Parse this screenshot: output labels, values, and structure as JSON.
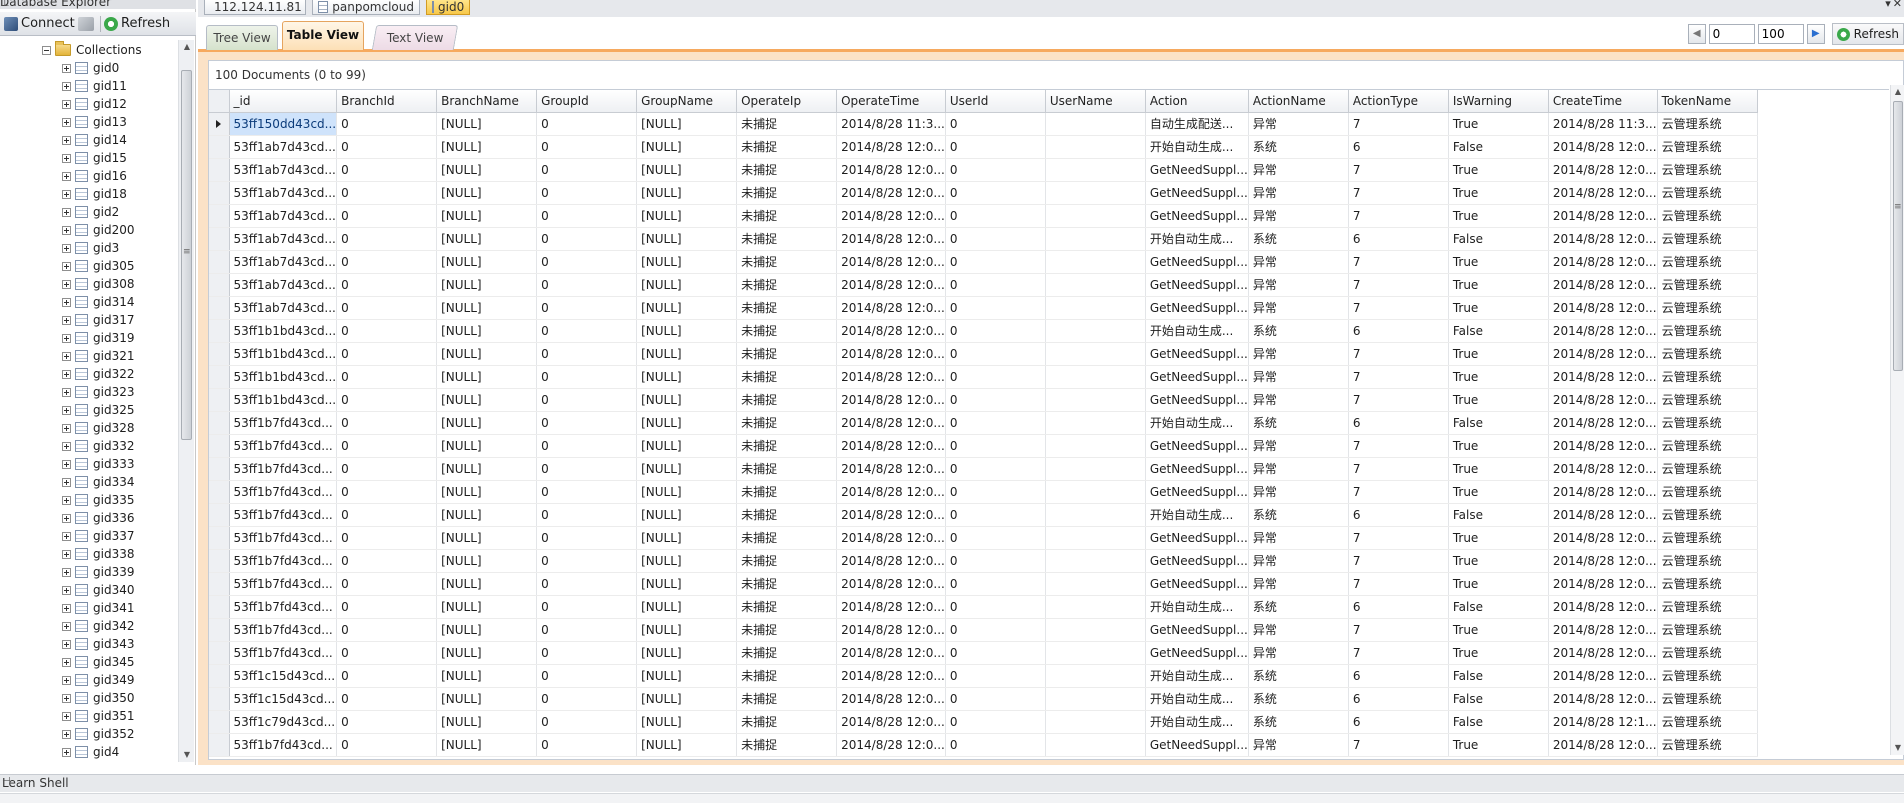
{
  "explorer": {
    "title": "Database Explorer",
    "connect_label": "Connect",
    "refresh_label": "Refresh",
    "collections_label": "Collections",
    "collections": [
      "gid0",
      "gid11",
      "gid12",
      "gid13",
      "gid14",
      "gid15",
      "gid16",
      "gid18",
      "gid2",
      "gid200",
      "gid3",
      "gid305",
      "gid308",
      "gid314",
      "gid317",
      "gid319",
      "gid321",
      "gid322",
      "gid323",
      "gid325",
      "gid328",
      "gid332",
      "gid333",
      "gid334",
      "gid335",
      "gid336",
      "gid337",
      "gid338",
      "gid339",
      "gid340",
      "gid341",
      "gid342",
      "gid343",
      "gid345",
      "gid349",
      "gid350",
      "gid351",
      "gid352",
      "gid4"
    ]
  },
  "doc_tabs": {
    "server": "112.124.11.81",
    "database": "panpomcloud",
    "collection": "gid0"
  },
  "view_tabs": {
    "tree": "Tree View",
    "table": "Table View",
    "text": "Text View"
  },
  "paging": {
    "skip": "0",
    "limit": "100",
    "refresh_label": "Refresh"
  },
  "result": {
    "count_label": "100 Documents (0 to 99)"
  },
  "grid": {
    "columns": [
      "_id",
      "BranchId",
      "BranchName",
      "GroupId",
      "GroupName",
      "OperateIp",
      "OperateTime",
      "UserId",
      "UserName",
      "Action",
      "ActionName",
      "ActionType",
      "IsWarning",
      "CreateTime",
      "TokenName"
    ],
    "rows": [
      [
        "53ff150dd43cd...",
        "0",
        "[NULL]",
        "0",
        "[NULL]",
        "未捕捉",
        "2014/8/28 11:3...",
        "0",
        "",
        "自动生成配送...",
        "异常",
        "7",
        "True",
        "2014/8/28 11:3...",
        "云管理系统"
      ],
      [
        "53ff1ab7d43cd...",
        "0",
        "[NULL]",
        "0",
        "[NULL]",
        "未捕捉",
        "2014/8/28 12:0...",
        "0",
        "",
        "开始自动生成...",
        "系统",
        "6",
        "False",
        "2014/8/28 12:0...",
        "云管理系统"
      ],
      [
        "53ff1ab7d43cd...",
        "0",
        "[NULL]",
        "0",
        "[NULL]",
        "未捕捉",
        "2014/8/28 12:0...",
        "0",
        "",
        "GetNeedSuppl...",
        "异常",
        "7",
        "True",
        "2014/8/28 12:0...",
        "云管理系统"
      ],
      [
        "53ff1ab7d43cd...",
        "0",
        "[NULL]",
        "0",
        "[NULL]",
        "未捕捉",
        "2014/8/28 12:0...",
        "0",
        "",
        "GetNeedSuppl...",
        "异常",
        "7",
        "True",
        "2014/8/28 12:0...",
        "云管理系统"
      ],
      [
        "53ff1ab7d43cd...",
        "0",
        "[NULL]",
        "0",
        "[NULL]",
        "未捕捉",
        "2014/8/28 12:0...",
        "0",
        "",
        "GetNeedSuppl...",
        "异常",
        "7",
        "True",
        "2014/8/28 12:0...",
        "云管理系统"
      ],
      [
        "53ff1ab7d43cd...",
        "0",
        "[NULL]",
        "0",
        "[NULL]",
        "未捕捉",
        "2014/8/28 12:0...",
        "0",
        "",
        "开始自动生成...",
        "系统",
        "6",
        "False",
        "2014/8/28 12:0...",
        "云管理系统"
      ],
      [
        "53ff1ab7d43cd...",
        "0",
        "[NULL]",
        "0",
        "[NULL]",
        "未捕捉",
        "2014/8/28 12:0...",
        "0",
        "",
        "GetNeedSuppl...",
        "异常",
        "7",
        "True",
        "2014/8/28 12:0...",
        "云管理系统"
      ],
      [
        "53ff1ab7d43cd...",
        "0",
        "[NULL]",
        "0",
        "[NULL]",
        "未捕捉",
        "2014/8/28 12:0...",
        "0",
        "",
        "GetNeedSuppl...",
        "异常",
        "7",
        "True",
        "2014/8/28 12:0...",
        "云管理系统"
      ],
      [
        "53ff1ab7d43cd...",
        "0",
        "[NULL]",
        "0",
        "[NULL]",
        "未捕捉",
        "2014/8/28 12:0...",
        "0",
        "",
        "GetNeedSuppl...",
        "异常",
        "7",
        "True",
        "2014/8/28 12:0...",
        "云管理系统"
      ],
      [
        "53ff1b1bd43cd...",
        "0",
        "[NULL]",
        "0",
        "[NULL]",
        "未捕捉",
        "2014/8/28 12:0...",
        "0",
        "",
        "开始自动生成...",
        "系统",
        "6",
        "False",
        "2014/8/28 12:0...",
        "云管理系统"
      ],
      [
        "53ff1b1bd43cd...",
        "0",
        "[NULL]",
        "0",
        "[NULL]",
        "未捕捉",
        "2014/8/28 12:0...",
        "0",
        "",
        "GetNeedSuppl...",
        "异常",
        "7",
        "True",
        "2014/8/28 12:0...",
        "云管理系统"
      ],
      [
        "53ff1b1bd43cd...",
        "0",
        "[NULL]",
        "0",
        "[NULL]",
        "未捕捉",
        "2014/8/28 12:0...",
        "0",
        "",
        "GetNeedSuppl...",
        "异常",
        "7",
        "True",
        "2014/8/28 12:0...",
        "云管理系统"
      ],
      [
        "53ff1b1bd43cd...",
        "0",
        "[NULL]",
        "0",
        "[NULL]",
        "未捕捉",
        "2014/8/28 12:0...",
        "0",
        "",
        "GetNeedSuppl...",
        "异常",
        "7",
        "True",
        "2014/8/28 12:0...",
        "云管理系统"
      ],
      [
        "53ff1b7fd43cd...",
        "0",
        "[NULL]",
        "0",
        "[NULL]",
        "未捕捉",
        "2014/8/28 12:0...",
        "0",
        "",
        "开始自动生成...",
        "系统",
        "6",
        "False",
        "2014/8/28 12:0...",
        "云管理系统"
      ],
      [
        "53ff1b7fd43cd...",
        "0",
        "[NULL]",
        "0",
        "[NULL]",
        "未捕捉",
        "2014/8/28 12:0...",
        "0",
        "",
        "GetNeedSuppl...",
        "异常",
        "7",
        "True",
        "2014/8/28 12:0...",
        "云管理系统"
      ],
      [
        "53ff1b7fd43cd...",
        "0",
        "[NULL]",
        "0",
        "[NULL]",
        "未捕捉",
        "2014/8/28 12:0...",
        "0",
        "",
        "GetNeedSuppl...",
        "异常",
        "7",
        "True",
        "2014/8/28 12:0...",
        "云管理系统"
      ],
      [
        "53ff1b7fd43cd...",
        "0",
        "[NULL]",
        "0",
        "[NULL]",
        "未捕捉",
        "2014/8/28 12:0...",
        "0",
        "",
        "GetNeedSuppl...",
        "异常",
        "7",
        "True",
        "2014/8/28 12:0...",
        "云管理系统"
      ],
      [
        "53ff1b7fd43cd...",
        "0",
        "[NULL]",
        "0",
        "[NULL]",
        "未捕捉",
        "2014/8/28 12:0...",
        "0",
        "",
        "开始自动生成...",
        "系统",
        "6",
        "False",
        "2014/8/28 12:0...",
        "云管理系统"
      ],
      [
        "53ff1b7fd43cd...",
        "0",
        "[NULL]",
        "0",
        "[NULL]",
        "未捕捉",
        "2014/8/28 12:0...",
        "0",
        "",
        "GetNeedSuppl...",
        "异常",
        "7",
        "True",
        "2014/8/28 12:0...",
        "云管理系统"
      ],
      [
        "53ff1b7fd43cd...",
        "0",
        "[NULL]",
        "0",
        "[NULL]",
        "未捕捉",
        "2014/8/28 12:0...",
        "0",
        "",
        "GetNeedSuppl...",
        "异常",
        "7",
        "True",
        "2014/8/28 12:0...",
        "云管理系统"
      ],
      [
        "53ff1b7fd43cd...",
        "0",
        "[NULL]",
        "0",
        "[NULL]",
        "未捕捉",
        "2014/8/28 12:0...",
        "0",
        "",
        "GetNeedSuppl...",
        "异常",
        "7",
        "True",
        "2014/8/28 12:0...",
        "云管理系统"
      ],
      [
        "53ff1b7fd43cd...",
        "0",
        "[NULL]",
        "0",
        "[NULL]",
        "未捕捉",
        "2014/8/28 12:0...",
        "0",
        "",
        "开始自动生成...",
        "系统",
        "6",
        "False",
        "2014/8/28 12:0...",
        "云管理系统"
      ],
      [
        "53ff1b7fd43cd...",
        "0",
        "[NULL]",
        "0",
        "[NULL]",
        "未捕捉",
        "2014/8/28 12:0...",
        "0",
        "",
        "GetNeedSuppl...",
        "异常",
        "7",
        "True",
        "2014/8/28 12:0...",
        "云管理系统"
      ],
      [
        "53ff1b7fd43cd...",
        "0",
        "[NULL]",
        "0",
        "[NULL]",
        "未捕捉",
        "2014/8/28 12:0...",
        "0",
        "",
        "GetNeedSuppl...",
        "异常",
        "7",
        "True",
        "2014/8/28 12:0...",
        "云管理系统"
      ],
      [
        "53ff1c15d43cd...",
        "0",
        "[NULL]",
        "0",
        "[NULL]",
        "未捕捉",
        "2014/8/28 12:0...",
        "0",
        "",
        "开始自动生成...",
        "系统",
        "6",
        "False",
        "2014/8/28 12:0...",
        "云管理系统"
      ],
      [
        "53ff1c15d43cd...",
        "0",
        "[NULL]",
        "0",
        "[NULL]",
        "未捕捉",
        "2014/8/28 12:0...",
        "0",
        "",
        "开始自动生成...",
        "系统",
        "6",
        "False",
        "2014/8/28 12:0...",
        "云管理系统"
      ],
      [
        "53ff1c79d43cd...",
        "0",
        "[NULL]",
        "0",
        "[NULL]",
        "未捕捉",
        "2014/8/28 12:0...",
        "0",
        "",
        "开始自动生成...",
        "系统",
        "6",
        "False",
        "2014/8/28 12:1...",
        "云管理系统"
      ],
      [
        "53ff1b7fd43cd...",
        "0",
        "[NULL]",
        "0",
        "[NULL]",
        "未捕捉",
        "2014/8/28 12:0...",
        "0",
        "",
        "GetNeedSuppl...",
        "异常",
        "7",
        "True",
        "2014/8/28 12:0...",
        "云管理系统"
      ]
    ]
  },
  "shell": {
    "title": "Learn Shell"
  },
  "colors": {
    "accent_orange": "#f6a95f",
    "selection_blue": "#cfe3fb",
    "folder_yellow": "#e3b43a"
  }
}
